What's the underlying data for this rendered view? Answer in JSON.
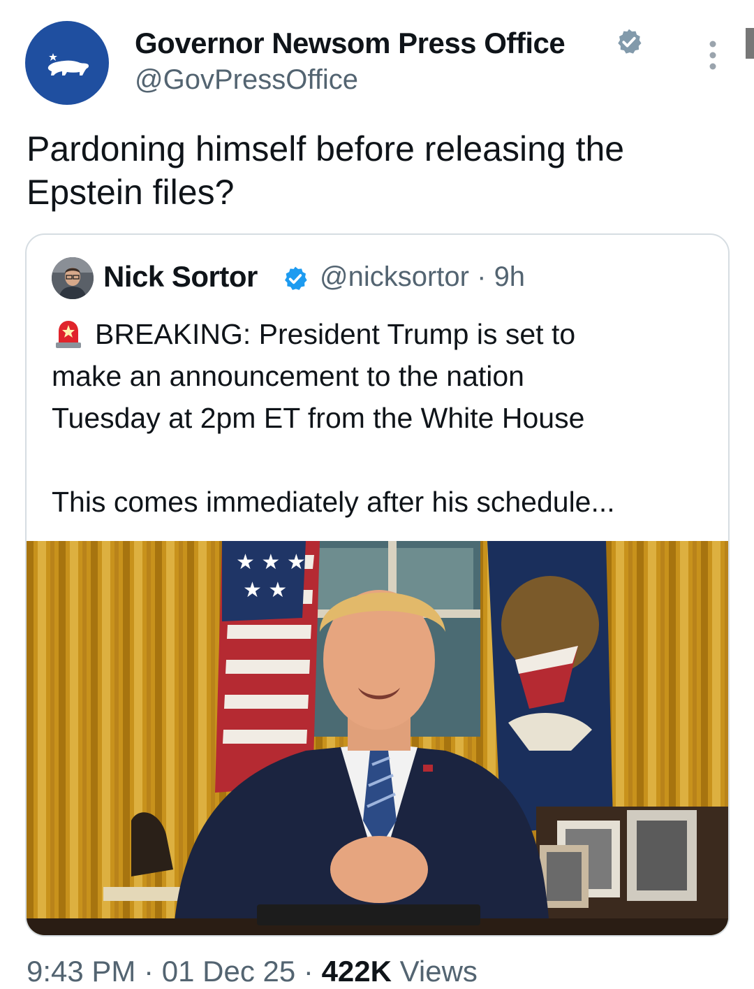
{
  "tweet": {
    "author": {
      "name": "Governor Newsom Press Office",
      "handle": "@GovPressOffice",
      "verified": true,
      "avatar_icon": "california-bear-icon",
      "avatar_color": "#1f4fa0"
    },
    "text_lines": [
      "Pardoning himself before releasing the",
      "Epstein files?"
    ],
    "quoted": {
      "author": {
        "name": "Nick Sortor",
        "handle": "@nicksortor",
        "separator": "·",
        "age": "9h",
        "verified": true
      },
      "lines": [
        "BREAKING: President Trump is set to",
        "make an announcement to the nation",
        "Tuesday at 2pm ET from the White House"
      ],
      "lead_icon": "siren-icon",
      "more": "This comes immediately after his schedule...",
      "media_icon": "oval-office-photo"
    },
    "meta": {
      "time": "9:43 PM",
      "sep1": "·",
      "date": "01 Dec 25",
      "sep2": "·",
      "views_count": "422K",
      "views_label": "Views"
    }
  },
  "colors": {
    "text": "#0f1419",
    "secondary": "#536471",
    "verified": "#829aab",
    "border": "#d6dde2"
  }
}
